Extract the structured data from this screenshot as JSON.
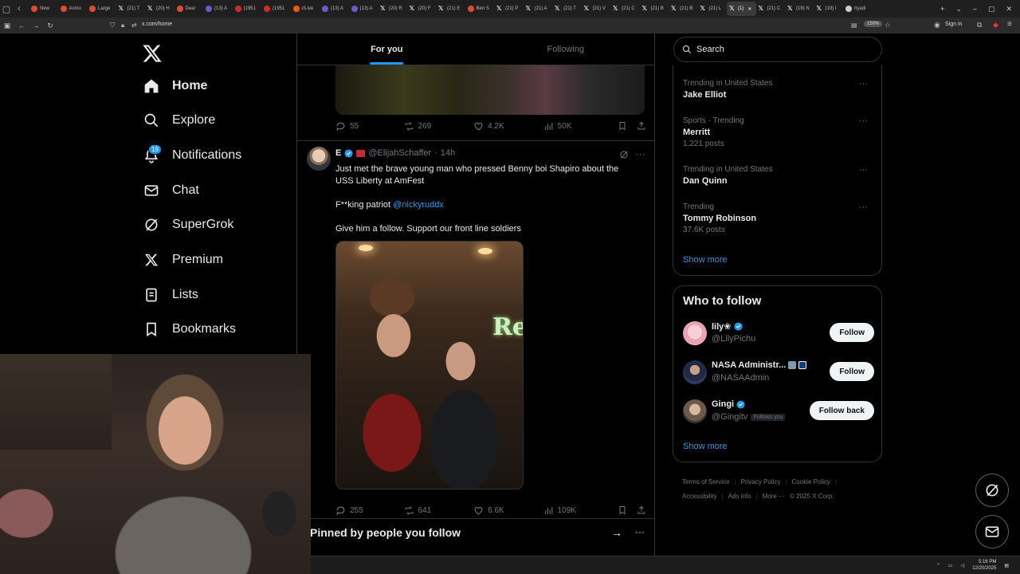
{
  "browser": {
    "tabs": [
      {
        "title": "New",
        "color": "#e34c26",
        "active": false
      },
      {
        "title": "Asmo",
        "color": "#e34c26",
        "active": false
      },
      {
        "title": "Large",
        "color": "#e34c26",
        "active": false
      },
      {
        "title": "(21) T",
        "color": "x",
        "active": false
      },
      {
        "title": "(20) H",
        "color": "x",
        "active": false
      },
      {
        "title": "Dear",
        "color": "#e34c26",
        "active": false
      },
      {
        "title": "(13) A",
        "color": "#6a5acd",
        "active": false
      },
      {
        "title": "(1951",
        "color": "#d62a2a",
        "active": false
      },
      {
        "title": "(1951",
        "color": "#d62a2a",
        "active": false
      },
      {
        "title": "r/Live",
        "color": "#ff5700",
        "active": false
      },
      {
        "title": "(13) A",
        "color": "#6a5acd",
        "active": false
      },
      {
        "title": "(13) A",
        "color": "#6a5acd",
        "active": false
      },
      {
        "title": "(20) R",
        "color": "x",
        "active": false
      },
      {
        "title": "(20) F",
        "color": "x",
        "active": false
      },
      {
        "title": "(21) E",
        "color": "x",
        "active": false
      },
      {
        "title": "Ben S",
        "color": "#e34c26",
        "active": false
      },
      {
        "title": "(21) P",
        "color": "x",
        "active": false
      },
      {
        "title": "(21) A",
        "color": "x",
        "active": false
      },
      {
        "title": "(21) T",
        "color": "x",
        "active": false
      },
      {
        "title": "(21) V",
        "color": "x",
        "active": false
      },
      {
        "title": "(21) C",
        "color": "x",
        "active": false
      },
      {
        "title": "(21) B",
        "color": "x",
        "active": false
      },
      {
        "title": "(21) B",
        "color": "x",
        "active": false
      },
      {
        "title": "(21) L",
        "color": "x",
        "active": false
      },
      {
        "title": "(1) ",
        "color": "x",
        "active": true
      },
      {
        "title": "(21) C",
        "color": "x",
        "active": false
      },
      {
        "title": "(19) N",
        "color": "x",
        "active": false
      },
      {
        "title": "(19) I",
        "color": "x",
        "active": false
      },
      {
        "title": "riyadi",
        "color": "#cccccc",
        "active": false
      }
    ],
    "url": "x.com/home",
    "zoom": "150%",
    "signin": "Sign in"
  },
  "nav": {
    "items": [
      {
        "label": "Home",
        "icon": "home-icon",
        "active": true
      },
      {
        "label": "Explore",
        "icon": "search-icon",
        "active": false
      },
      {
        "label": "Notifications",
        "icon": "bell-icon",
        "active": false
      },
      {
        "label": "Chat",
        "icon": "mail-icon",
        "active": false
      },
      {
        "label": "SuperGrok",
        "icon": "grok-icon",
        "active": false
      },
      {
        "label": "Premium",
        "icon": "x-logo-icon",
        "active": false
      },
      {
        "label": "Lists",
        "icon": "list-icon",
        "active": false
      },
      {
        "label": "Bookmarks",
        "icon": "bookmark-icon",
        "active": false
      }
    ],
    "notif_badge": "19"
  },
  "timeline": {
    "tabs": [
      "For you",
      "Following"
    ],
    "prev_actions": {
      "replies": "55",
      "reposts": "269",
      "likes": "4.2K",
      "views": "50K"
    },
    "tweet": {
      "name": "E",
      "handle": "@ElijahSchaffer",
      "dot": "·",
      "time": "14h",
      "line1": "Just met the brave young man who pressed Benny boi Shapiro about the",
      "line2": "USS Liberty at AmFest",
      "line3a": "F**king patriot ",
      "mention": "@nickyruddx",
      "line4": "Give him a follow. Support our front line soldiers",
      "media_sign": "Re",
      "actions": {
        "replies": "255",
        "reposts": "641",
        "likes": "6.6K",
        "views": "109K"
      }
    },
    "pinned_title": "Pinned by people you follow"
  },
  "sidebar": {
    "search_placeholder": "Search",
    "trends": [
      {
        "context": "Trending in United States",
        "name": "Jake Elliot",
        "posts": ""
      },
      {
        "context": "Sports · Trending",
        "name": "Merritt",
        "posts": "1,221 posts"
      },
      {
        "context": "Trending in United States",
        "name": "Dan Quinn",
        "posts": ""
      },
      {
        "context": "Trending",
        "name": "Tommy Robinson",
        "posts": "37.6K posts"
      }
    ],
    "trends_show_more": "Show more",
    "wtf_title": "Who to follow",
    "follow": [
      {
        "name": "lily❀",
        "handle": "@LilyPichu",
        "button": "Follow",
        "follows_you": ""
      },
      {
        "name": "NASA Administr...",
        "handle": "@NASAAdmin",
        "button": "Follow",
        "follows_you": ""
      },
      {
        "name": "Gingi",
        "handle": "@Gingitv",
        "button": "Follow back",
        "follows_you": "Follows you"
      }
    ],
    "wtf_show_more": "Show more",
    "footer": [
      "Terms of Service",
      "Privacy Policy",
      "Cookie Policy",
      "Accessibility",
      "Ads info",
      "More ···",
      "© 2025 X Corp."
    ],
    "footer_sep": "|"
  },
  "taskbar": {
    "time": "5:16 PM",
    "date": "12/20/2025"
  },
  "colors": {
    "accent": "#1d9bf0",
    "border": "#2f3336",
    "muted": "#71767b"
  }
}
